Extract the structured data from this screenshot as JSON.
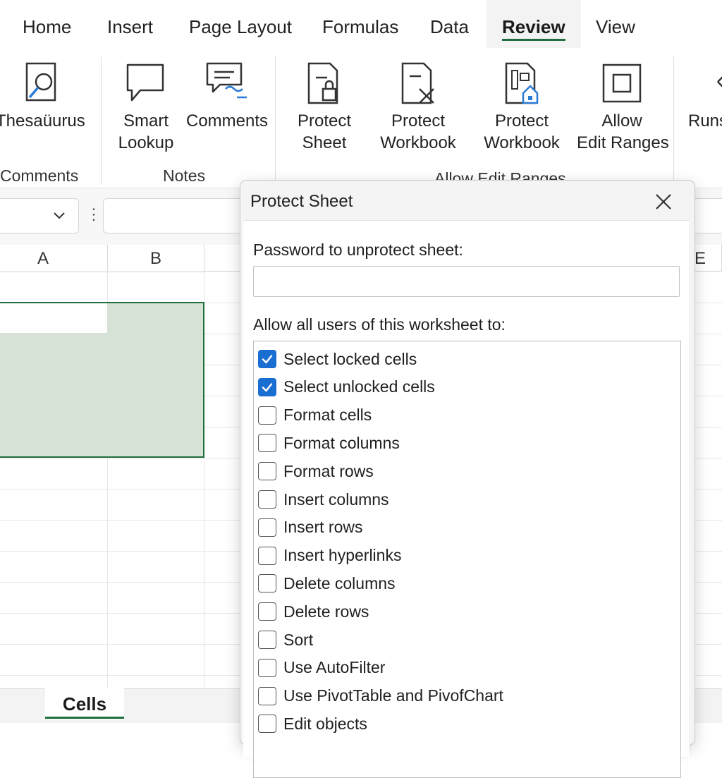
{
  "tabs": [
    {
      "label": "Home",
      "active": false
    },
    {
      "label": "Insert",
      "active": false
    },
    {
      "label": "Page Layout",
      "active": false
    },
    {
      "label": "Formulas",
      "active": false
    },
    {
      "label": "Data",
      "active": false
    },
    {
      "label": "Review",
      "active": true
    },
    {
      "label": "View",
      "active": false
    }
  ],
  "ribbon": {
    "thesaurus": "Thesaüurus",
    "smart_lookup": [
      "Smart",
      "Lookup"
    ],
    "comments": "Comments",
    "protect_sheet": [
      "Protect",
      "Sheet"
    ],
    "protect_workbook_1": [
      "Protect",
      "Workbook"
    ],
    "protect_workbook_2": [
      "Protect",
      "Workbook"
    ],
    "allow_edit_ranges": [
      "Allow",
      "Edit Ranges"
    ],
    "runs": "Runs",
    "groups": {
      "comments": "Comments",
      "notes": "Notes",
      "allow_edit_ranges": "Allow Edit Ranges"
    }
  },
  "grid": {
    "columns": [
      "A",
      "B",
      "E"
    ]
  },
  "sheet_tab": "Cells",
  "dialog": {
    "title": "Protect Sheet",
    "password_label": "Password to unprotect sheet:",
    "password_value": "",
    "allow_label": "Allow all users of this worksheet to:",
    "permissions": [
      {
        "label": "Select locked cells",
        "checked": true
      },
      {
        "label": "Select unlocked cells",
        "checked": true
      },
      {
        "label": "Format cells",
        "checked": false
      },
      {
        "label": "Format columns",
        "checked": false
      },
      {
        "label": "Format rows",
        "checked": false
      },
      {
        "label": "Insert columns",
        "checked": false
      },
      {
        "label": "Insert rows",
        "checked": false
      },
      {
        "label": "Insert hyperlinks",
        "checked": false
      },
      {
        "label": "Delete columns",
        "checked": false
      },
      {
        "label": "Delete rows",
        "checked": false
      },
      {
        "label": "Sort",
        "checked": false
      },
      {
        "label": "Use AutoFilter",
        "checked": false
      },
      {
        "label": "Use PivotTable and PivofChart",
        "checked": false
      },
      {
        "label": "Edit objects",
        "checked": false
      }
    ]
  },
  "colors": {
    "accent_green": "#1e6f3d",
    "selection_fill": "#d6e2d6",
    "checkbox_blue": "#1b6ed1"
  }
}
